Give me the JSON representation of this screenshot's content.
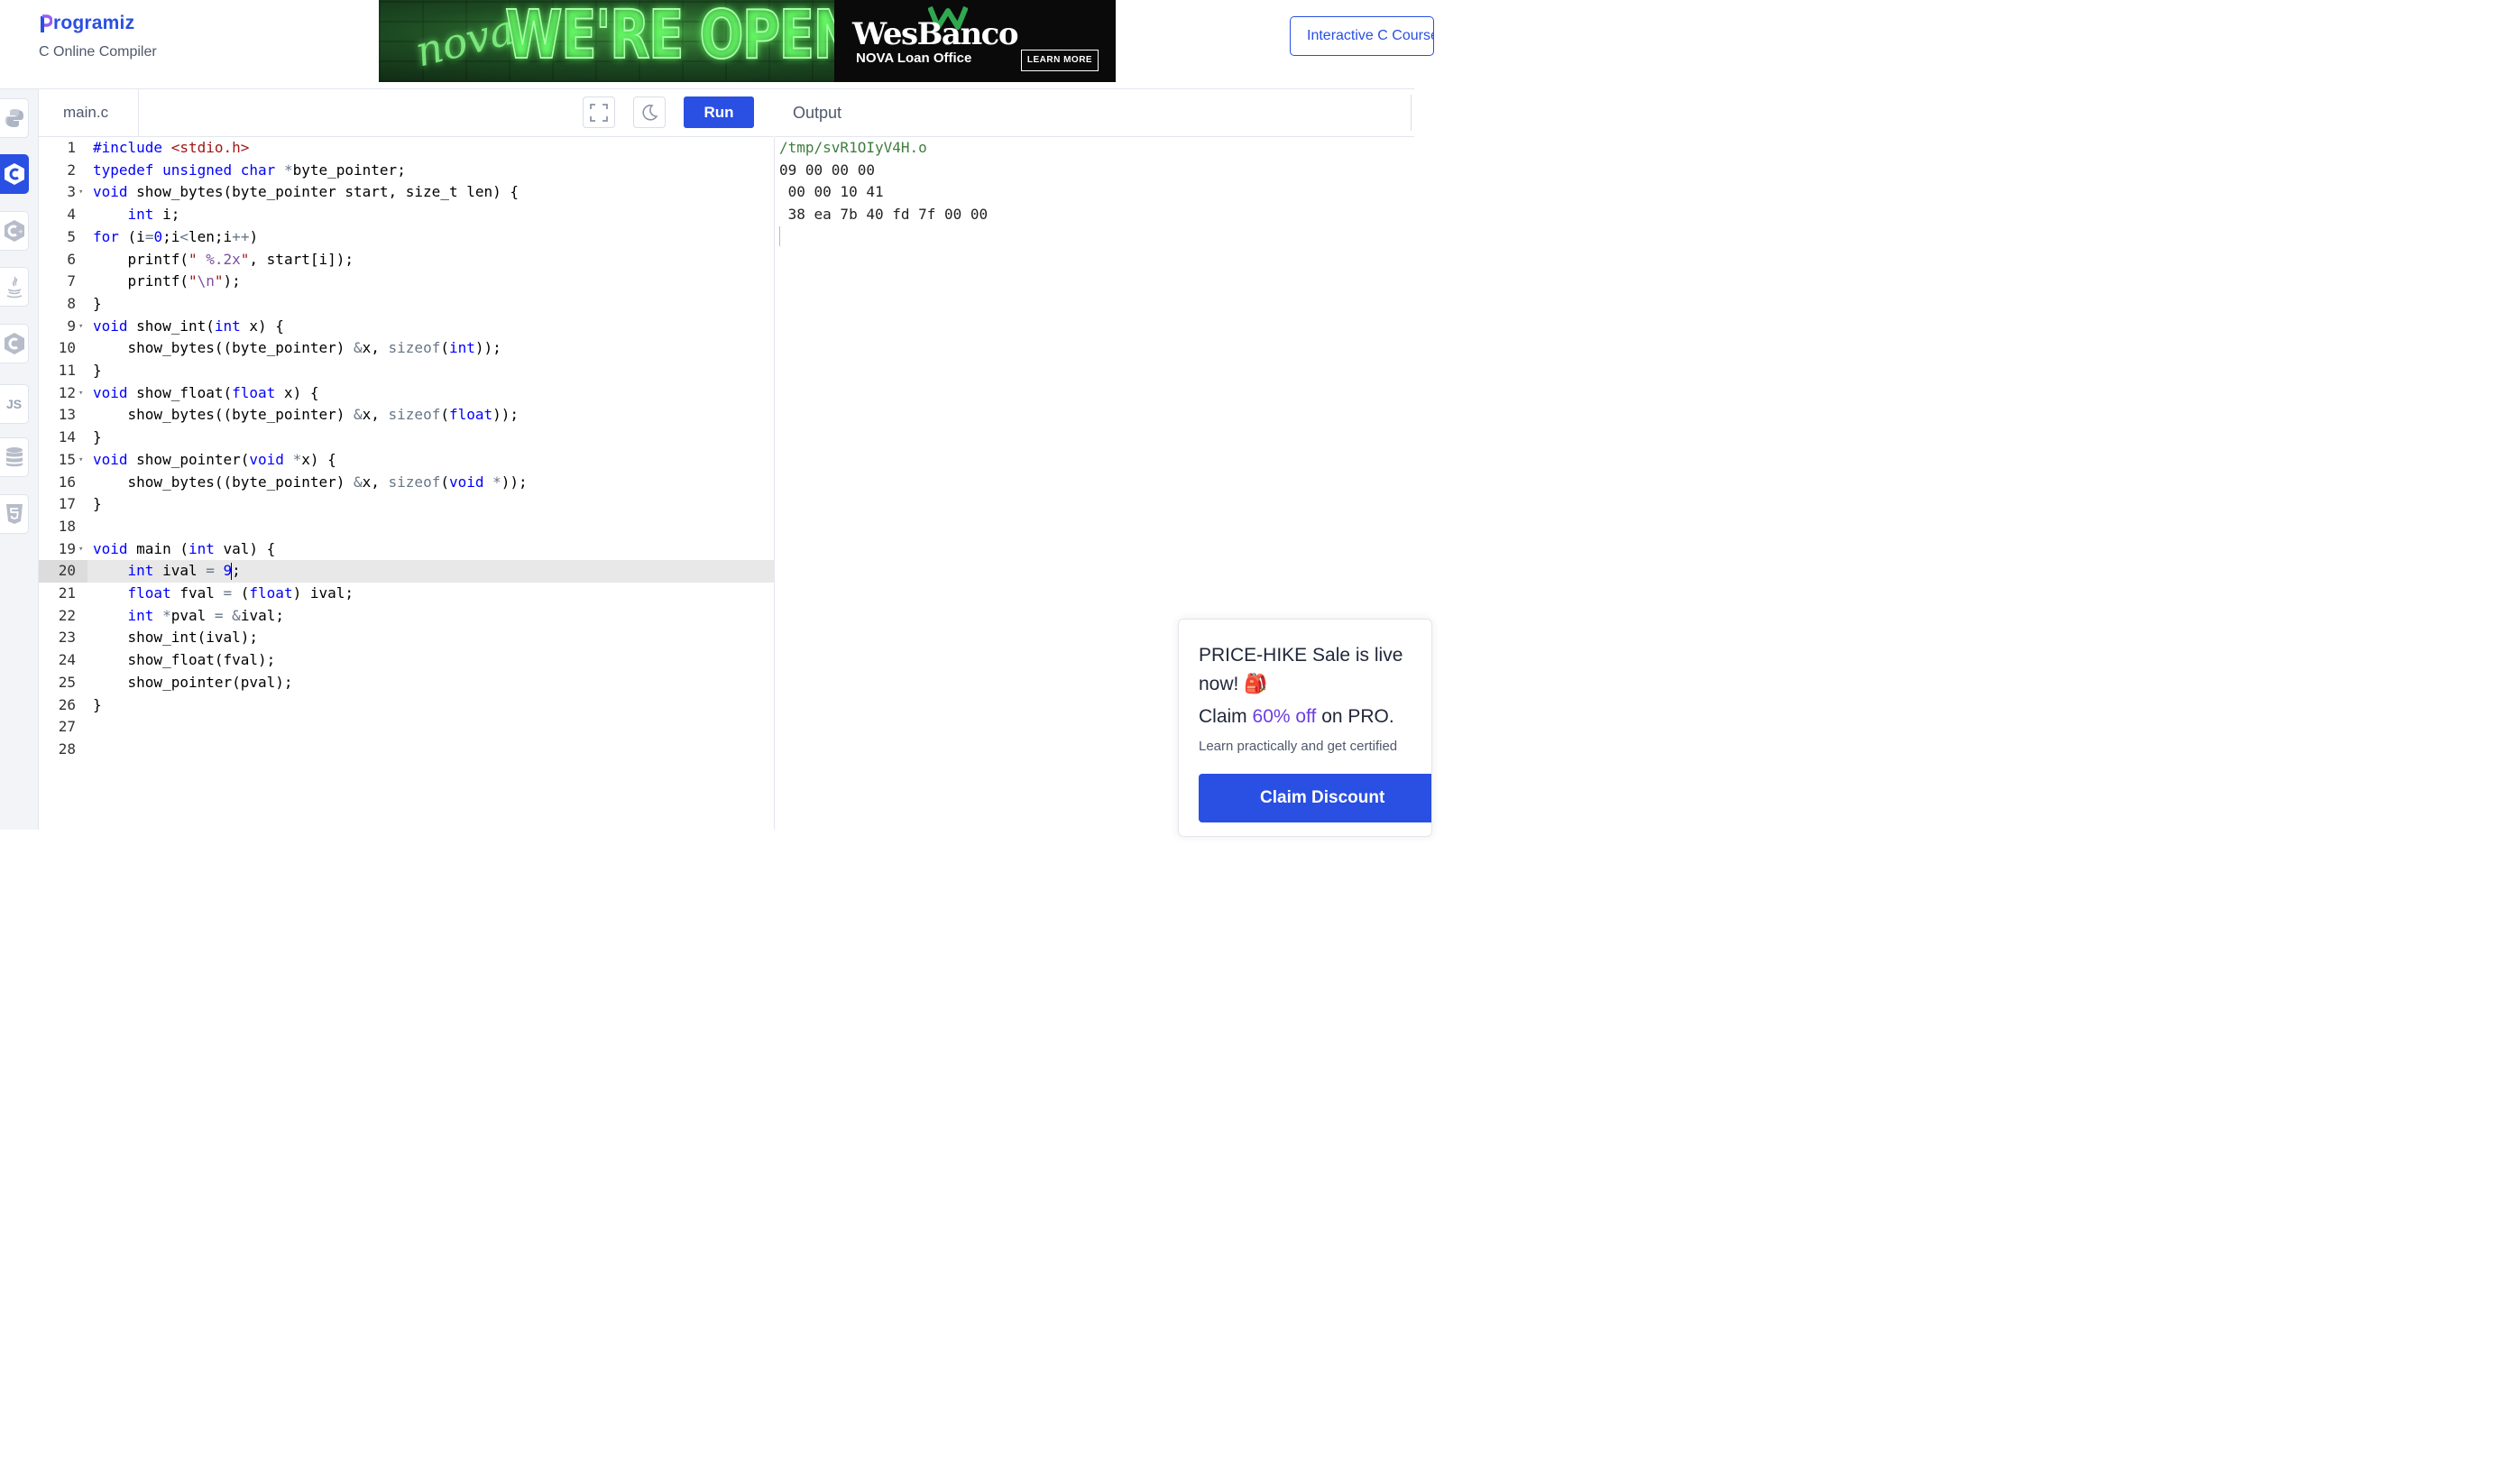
{
  "header": {
    "logo_text": "rogramiz",
    "subtitle": "C Online Compiler",
    "interactive_button": "Interactive C Course"
  },
  "ad": {
    "script_text": "nova",
    "headline": "WE'RE OPEN",
    "brand": "WesBanco",
    "subline": "NOVA Loan Office",
    "cta": "LEARN MORE",
    "choices": "▷✕"
  },
  "sidebar": {
    "languages": [
      {
        "icon": "python-icon",
        "active": false
      },
      {
        "icon": "c-icon",
        "active": true
      },
      {
        "icon": "cpp-icon",
        "active": false
      },
      {
        "icon": "java-icon",
        "active": false
      },
      {
        "icon": "csharp-icon",
        "active": false
      },
      {
        "icon": "js-icon",
        "label": "JS",
        "active": false
      },
      {
        "icon": "sql-icon",
        "active": false
      },
      {
        "icon": "html5-icon",
        "active": false
      }
    ]
  },
  "editor": {
    "file_name": "main.c",
    "run_label": "Run",
    "active_line": 20,
    "lines": [
      "#include <stdio.h>",
      "typedef unsigned char *byte_pointer;",
      "void show_bytes(byte_pointer start, size_t len) {",
      "    int i;",
      "for (i=0;i<len;i++)",
      "    printf(\" %.2x\", start[i]);",
      "    printf(\"\\n\");",
      "}",
      "void show_int(int x) {",
      "    show_bytes((byte_pointer) &x, sizeof(int));",
      "}",
      "void show_float(float x) {",
      "    show_bytes((byte_pointer) &x, sizeof(float));",
      "}",
      "void show_pointer(void *x) {",
      "    show_bytes((byte_pointer) &x, sizeof(void *));",
      "}",
      "",
      "void main (int val) {",
      "    int ival = 9;",
      "    float fval = (float) ival;",
      "    int *pval = &ival;",
      "    show_int(ival);",
      "    show_float(fval);",
      "    show_pointer(pval);",
      "}",
      "",
      ""
    ],
    "folds": [
      3,
      9,
      12,
      15,
      19
    ]
  },
  "output": {
    "title": "Output",
    "lines": [
      "/tmp/svR1OIyV4H.o",
      "09 00 00 00",
      " 00 00 10 41",
      " 38 ea 7b 40 fd 7f 00 00"
    ]
  },
  "promo": {
    "title": "PRICE-HIKE Sale is live now! 🎒",
    "claim_prefix": "Claim ",
    "claim_accent": "60% off",
    "claim_suffix": " on PRO.",
    "learn": "Learn practically and get certified",
    "button": "Claim Discount"
  },
  "colors": {
    "brand_blue": "#2a4fe3",
    "keyword": "#0000ff",
    "string": "#a31515",
    "output_path": "#3f7d3f",
    "promo_accent": "#6b3fe0"
  }
}
